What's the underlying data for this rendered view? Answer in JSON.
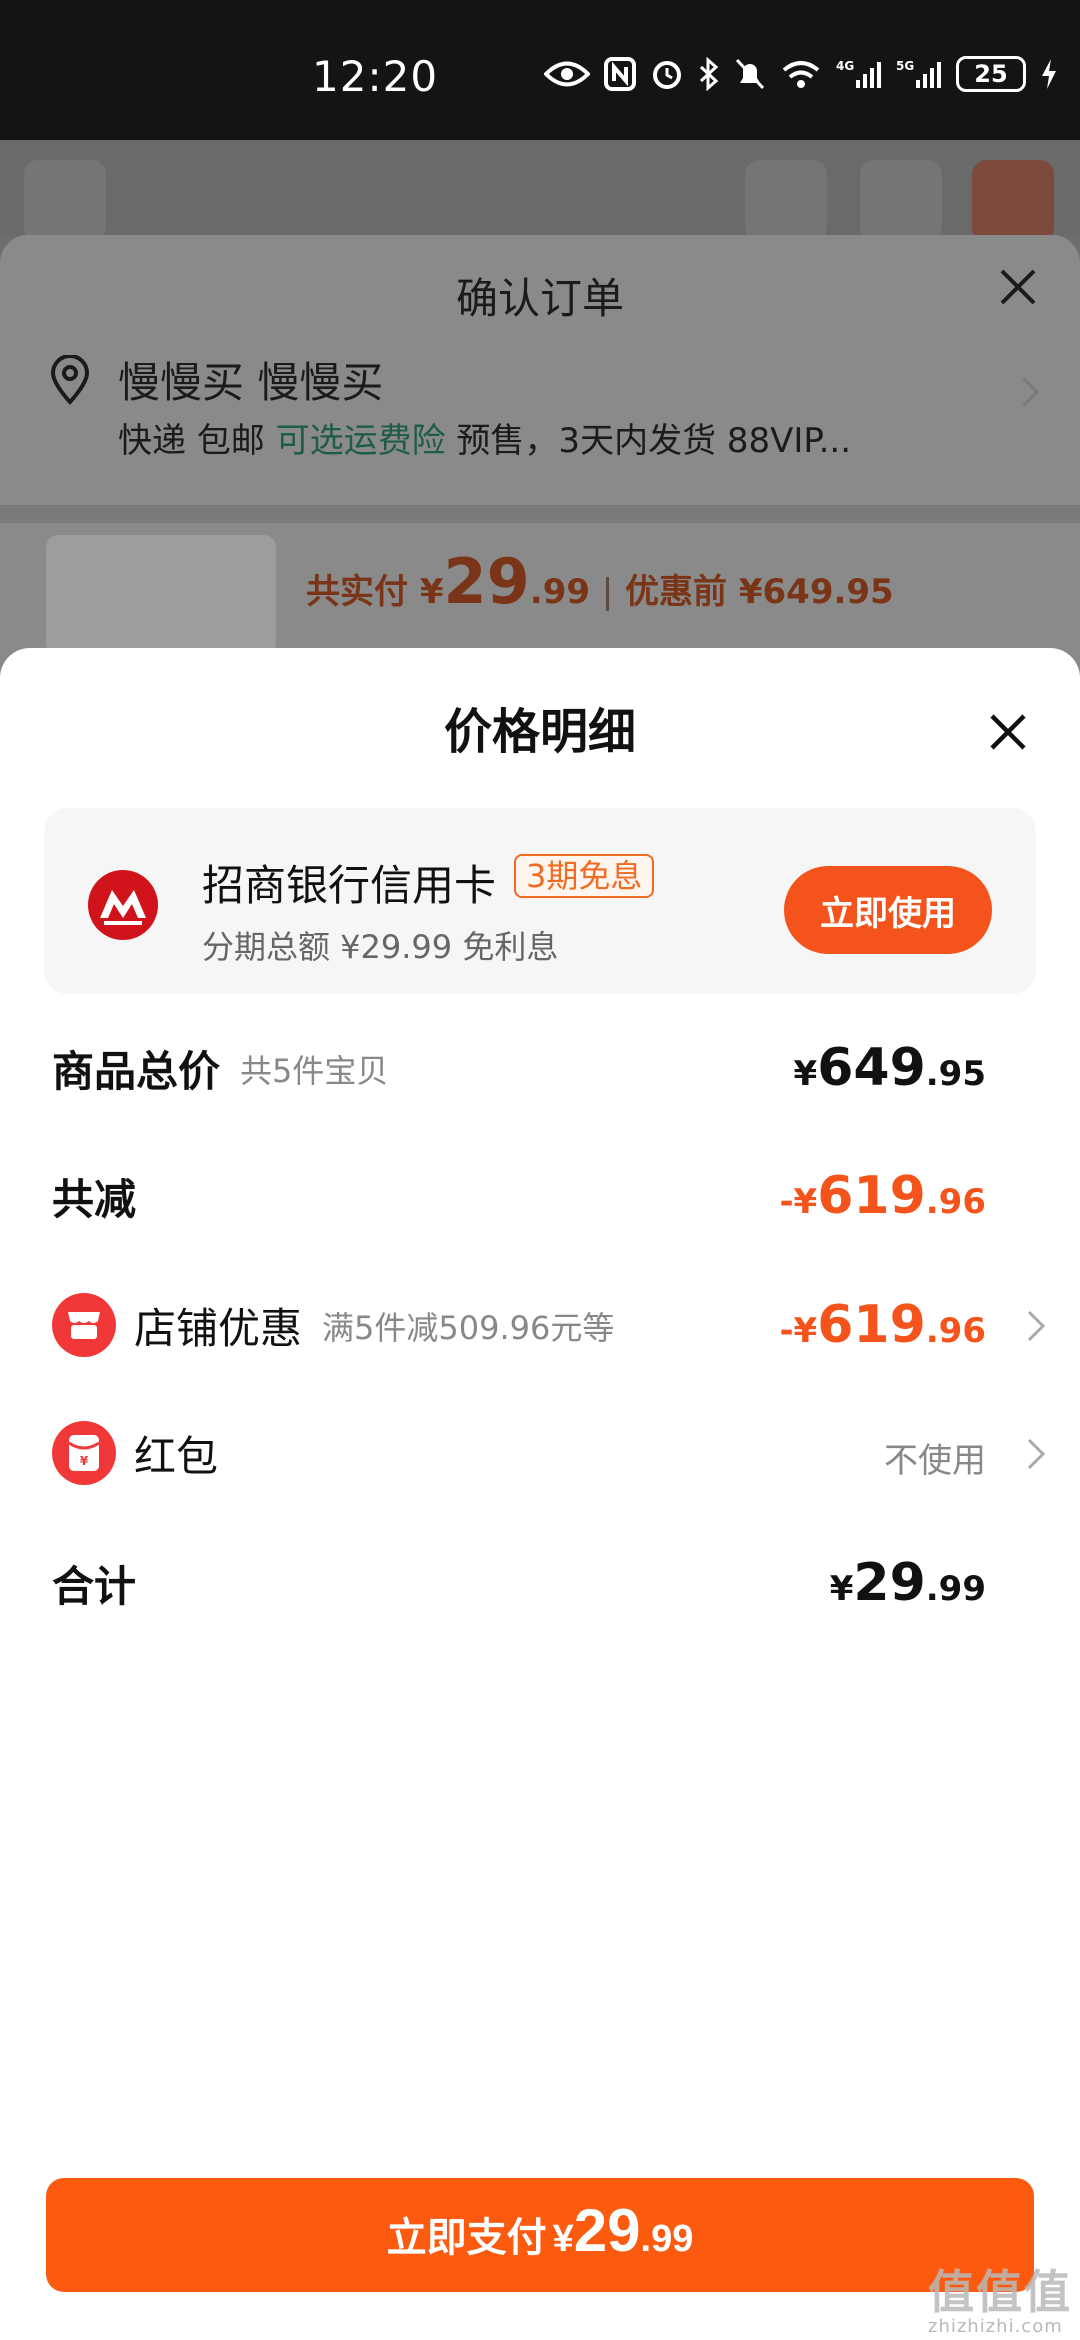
{
  "status_bar": {
    "time": "12:20",
    "battery": "25"
  },
  "background": {
    "confirm_title": "确认订单",
    "address_name": "慢慢买 慢慢买",
    "shipping_prefix": "快递 包邮 ",
    "shipping_link": "可选运费险",
    "shipping_suffix": " 预售，3天内发货 88VIP...",
    "pay_label": "共实付 ¥",
    "pay_int": "29",
    "pay_dec": ".99",
    "original_label": "优惠前 ¥649.95"
  },
  "sheet": {
    "title": "价格明细",
    "promo": {
      "bank": "招商银行信用卡",
      "badge": "3期免息",
      "subtitle": "分期总额 ¥29.99 免利息",
      "button": "立即使用"
    },
    "rows": {
      "goods_total": {
        "label": "商品总价",
        "note": "共5件宝贝",
        "sym": "¥",
        "int": "649",
        "dec": ".95"
      },
      "total_reduce": {
        "label": "共减",
        "sym": "-¥",
        "int": "619",
        "dec": ".96"
      },
      "shop_discount": {
        "label": "店铺优惠",
        "note": "满5件减509.96元等",
        "sym": "-¥",
        "int": "619",
        "dec": ".96"
      },
      "red_packet": {
        "label": "红包",
        "value": "不使用"
      },
      "sum": {
        "label": "合计",
        "sym": "¥",
        "int": "29",
        "dec": ".99"
      }
    },
    "pay_button": {
      "label": "立即支付",
      "sym": "¥",
      "int": "29",
      "dec": ".99"
    }
  },
  "watermark": {
    "main": "值值值",
    "sub": "zhizhizhi.com"
  },
  "colors": {
    "accent": "#f4541c",
    "pay_button": "#fb5a0f",
    "status_bar": "#141414"
  }
}
